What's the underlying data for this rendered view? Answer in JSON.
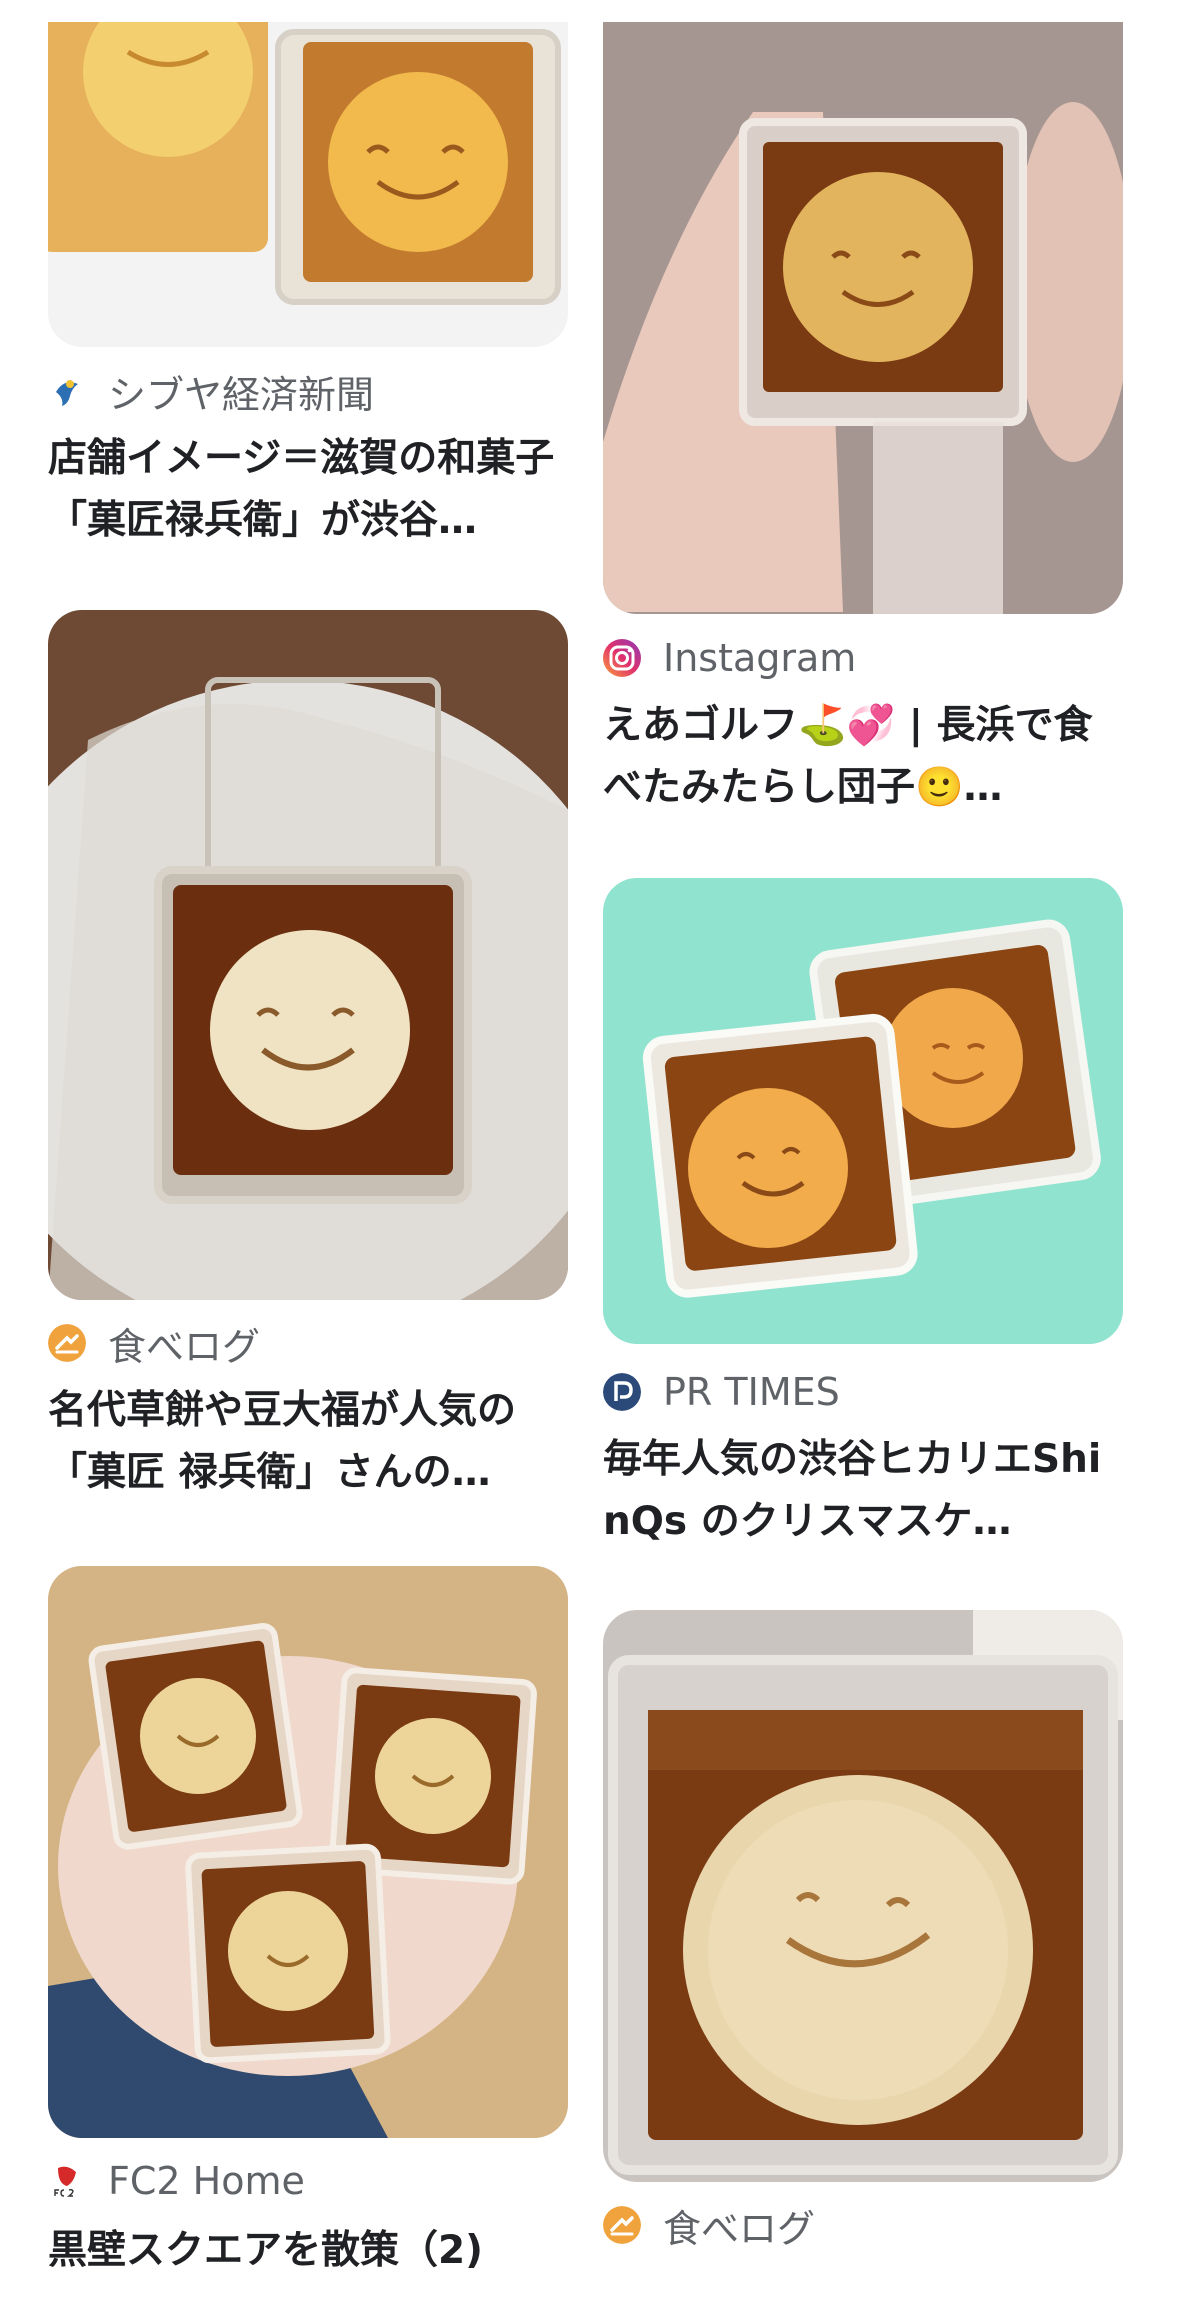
{
  "results": [
    {
      "source": "シブヤ経済新聞",
      "source_icon": "shibuya-bird-icon",
      "title": "店舗イメージ＝滋賀の和菓子「菓匠禄兵衛」が渋谷…"
    },
    {
      "source": "Instagram",
      "source_icon": "instagram-icon",
      "title": "えあゴルフ⛳💞 | 長浜で食べたみたらし団子🙂…"
    },
    {
      "source": "食べログ",
      "source_icon": "tabelog-icon",
      "title": "名代草餅や豆大福が人気の「菓匠 禄兵衛」さんの…"
    },
    {
      "source": "PR TIMES",
      "source_icon": "prtimes-icon",
      "title": "毎年人気の渋谷ヒカリエShinQs のクリスマスケ…"
    },
    {
      "source": "FC2 Home",
      "source_icon": "fc2-icon",
      "title": "黒壁スクエアを散策（2)"
    },
    {
      "source": "食べログ",
      "source_icon": "tabelog-icon"
    }
  ],
  "colors": {
    "syrup": "#7a3a12",
    "dango": "#f2c46a",
    "mint_bg": "#8fe3cf",
    "text": "#202124",
    "source_text": "#5f6368"
  }
}
